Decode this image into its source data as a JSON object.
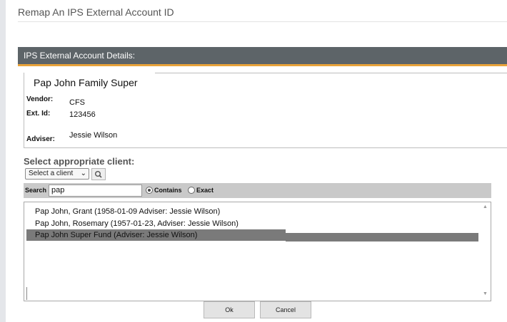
{
  "page": {
    "title": "Remap An IPS External Account ID"
  },
  "panel": {
    "header": "IPS External Account Details:",
    "entity_name": "Pap John Family Super",
    "fields": {
      "vendor_label": "Vendor:",
      "vendor_value": "CFS",
      "ext_id_label": "Ext. Id:",
      "ext_id_value": "123456",
      "adviser_label": "Adviser:",
      "adviser_value": "Jessie Wilson"
    }
  },
  "client_select": {
    "heading": "Select appropriate client:",
    "dropdown_value": "Select a client",
    "search_label": "Search",
    "search_value": "pap",
    "match_options": [
      "Contains",
      "Exact"
    ],
    "selected_match": "Contains",
    "results": [
      "Pap John, Grant (1958-01-09 Adviser: Jessie Wilson)",
      "Pap John, Rosemary (1957-01-23, Adviser: Jessie Wilson)",
      "Pap John Super Fund (Adviser: Jessie Wilson)"
    ],
    "selected_result_index": 2
  },
  "buttons": {
    "ok": "Ok",
    "cancel": "Cancel"
  },
  "colors": {
    "header_bg": "#5d6468",
    "accent": "#e8a33a",
    "selection": "#7a7a7a"
  },
  "icons": {
    "search_button": "magnifier-icon",
    "dropdown": "chevron-down-icon"
  }
}
